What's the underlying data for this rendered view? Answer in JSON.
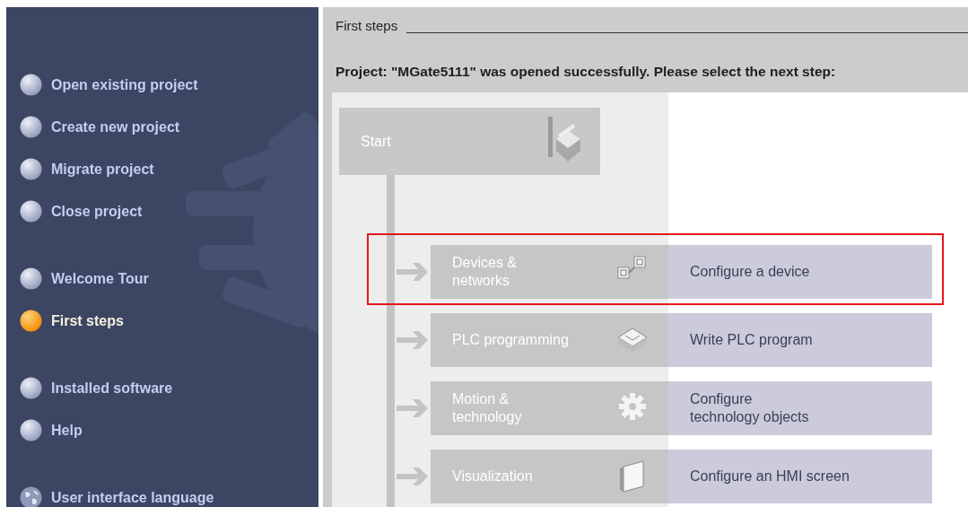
{
  "sidebar": {
    "groups": [
      [
        {
          "label": "Open existing project",
          "kind": "bulb",
          "selected": false
        },
        {
          "label": "Create new project",
          "kind": "bulb",
          "selected": false
        },
        {
          "label": "Migrate project",
          "kind": "bulb",
          "selected": false
        },
        {
          "label": "Close project",
          "kind": "bulb",
          "selected": false
        }
      ],
      [
        {
          "label": "Welcome Tour",
          "kind": "bulb",
          "selected": false
        },
        {
          "label": "First steps",
          "kind": "bulb",
          "selected": true
        }
      ],
      [
        {
          "label": "Installed software",
          "kind": "bulb",
          "selected": false
        },
        {
          "label": "Help",
          "kind": "bulb",
          "selected": false
        }
      ],
      [
        {
          "label": "User interface language",
          "kind": "globe",
          "selected": false
        }
      ]
    ]
  },
  "header": {
    "title": "First steps",
    "message": "Project: \"MGate5111\" was opened successfully. Please select the next step:"
  },
  "start": {
    "label": "Start"
  },
  "steps": [
    {
      "label": "Devices &\nnetworks",
      "kind": "devices",
      "action": "Configure a device",
      "highlighted": true
    },
    {
      "label": "PLC programming",
      "kind": "plc",
      "action": "Write PLC program",
      "highlighted": false
    },
    {
      "label": "Motion &\ntechnology",
      "kind": "gear",
      "action": "Configure\ntechnology objects",
      "highlighted": false
    },
    {
      "label": "Visualization",
      "kind": "hmi",
      "action": "Configure an HMI screen",
      "highlighted": false
    }
  ]
}
